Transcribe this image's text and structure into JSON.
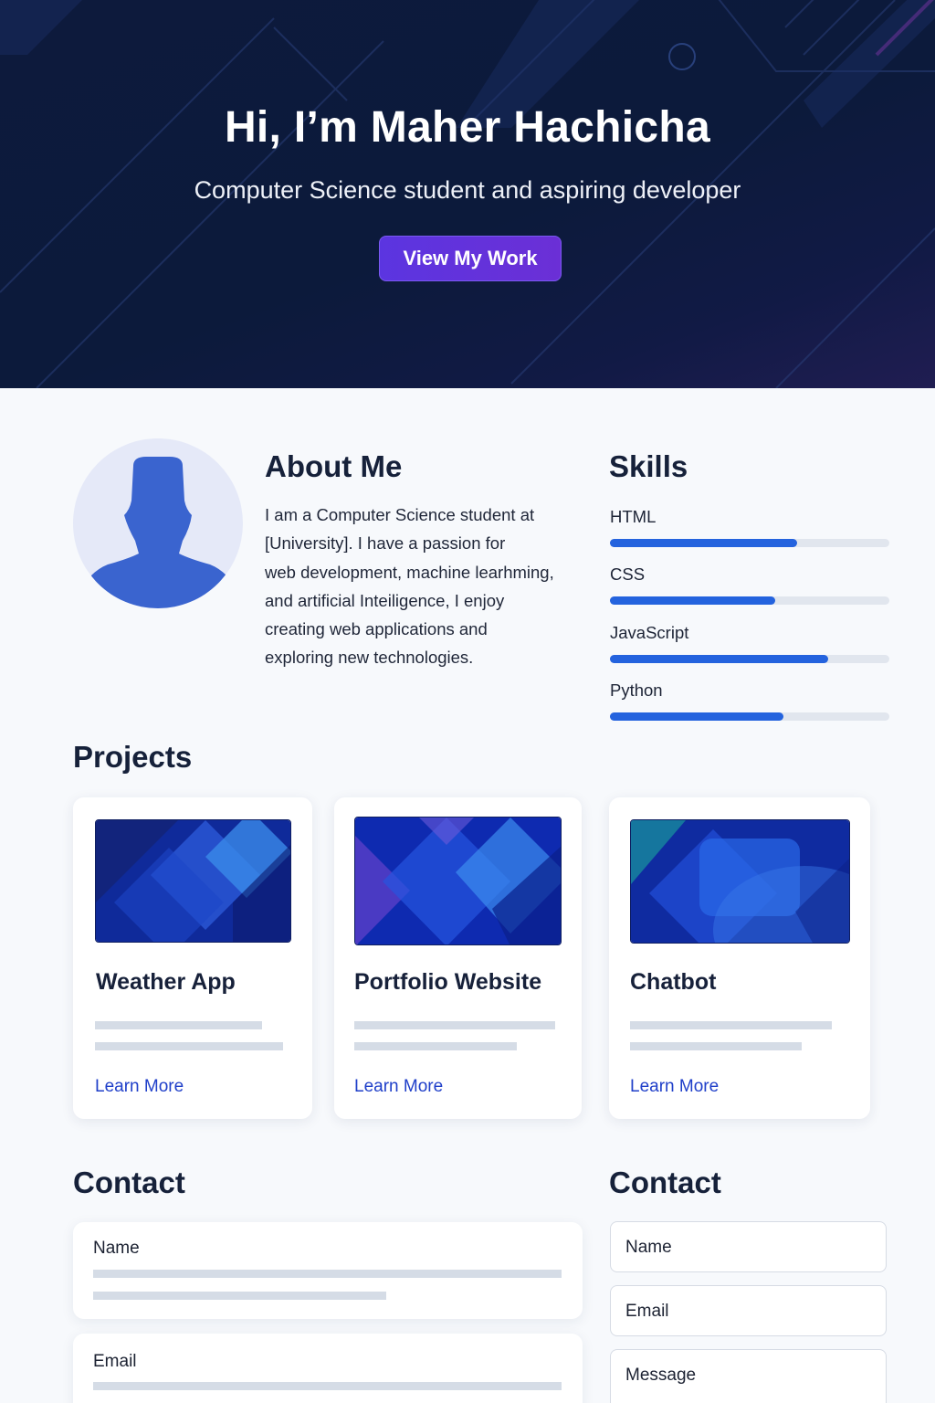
{
  "hero": {
    "title": "Hi, I’m Maher Hachicha",
    "subtitle": "Computer Science student and aspiring developer",
    "button_label": "View My Work"
  },
  "about": {
    "heading": "About Me",
    "lines": [
      "I am a Computer Science student at",
      "[University]. I have a passion for",
      "web development, machine learhming,",
      "and artificial Inteiligence, I enjoy",
      "creating web applications and",
      "exploring new technologies."
    ]
  },
  "skills": {
    "heading": "Skills",
    "items": [
      {
        "label": "HTML",
        "level": 0.67
      },
      {
        "label": "CSS",
        "level": 0.59
      },
      {
        "label": "JavaScript",
        "level": 0.78
      },
      {
        "label": "Python",
        "level": 0.62
      }
    ]
  },
  "projects": {
    "heading": "Projects",
    "items": [
      {
        "title": "Weather App",
        "link": "Learn More"
      },
      {
        "title": "Portfolio Website",
        "link": "Learn More"
      },
      {
        "title": "Chatbot",
        "link": "Learn More"
      }
    ]
  },
  "contact_left": {
    "heading": "Contact",
    "name_label": "Name",
    "email_label": "Email"
  },
  "contact_right": {
    "heading": "Contact",
    "name_placeholder": "Name",
    "email_placeholder": "Email",
    "message_placeholder": "Message"
  },
  "colors": {
    "hero_bg": "#0d1a3c",
    "accent_button": "#5b35e0",
    "skill_fill": "#2463de",
    "link": "#1f3fc9"
  },
  "icons": {
    "avatar": "user-silhouette-icon"
  }
}
